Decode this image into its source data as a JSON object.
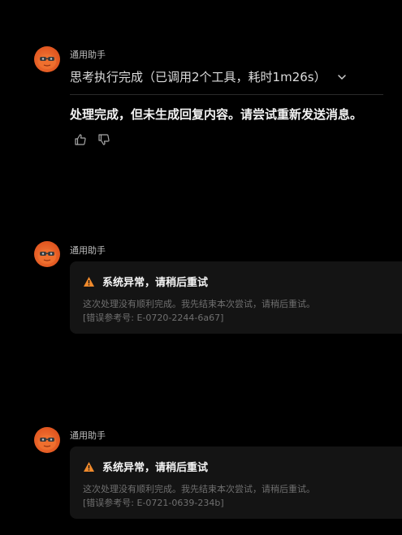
{
  "colors": {
    "background": "#000000",
    "card": "#141414",
    "warning": "#f08a2c",
    "avatar": "#e45a22"
  },
  "messages": [
    {
      "sender": "通用助手",
      "thought_summary": "思考执行完成（已调用2个工具，耗时1m26s）",
      "answer": "处理完成，但未生成回复内容。请尝试重新发送消息。",
      "icons": [
        "thumbs-up-icon",
        "thumbs-down-icon",
        "chevron-down-icon"
      ]
    },
    {
      "sender": "通用助手",
      "error_title": "系统异常，请稍后重试",
      "error_desc": "这次处理没有顺利完成。我先结束本次尝试，请稍后重试。",
      "error_code": "[错误参考号: E-0720-2244-6a67]",
      "icon": "warning-icon"
    },
    {
      "sender": "通用助手",
      "error_title": "系统异常，请稍后重试",
      "error_desc": "这次处理没有顺利完成。我先结束本次尝试，请稍后重试。",
      "error_code": "[错误参考号: E-0721-0639-234b]",
      "icon": "warning-icon"
    }
  ]
}
